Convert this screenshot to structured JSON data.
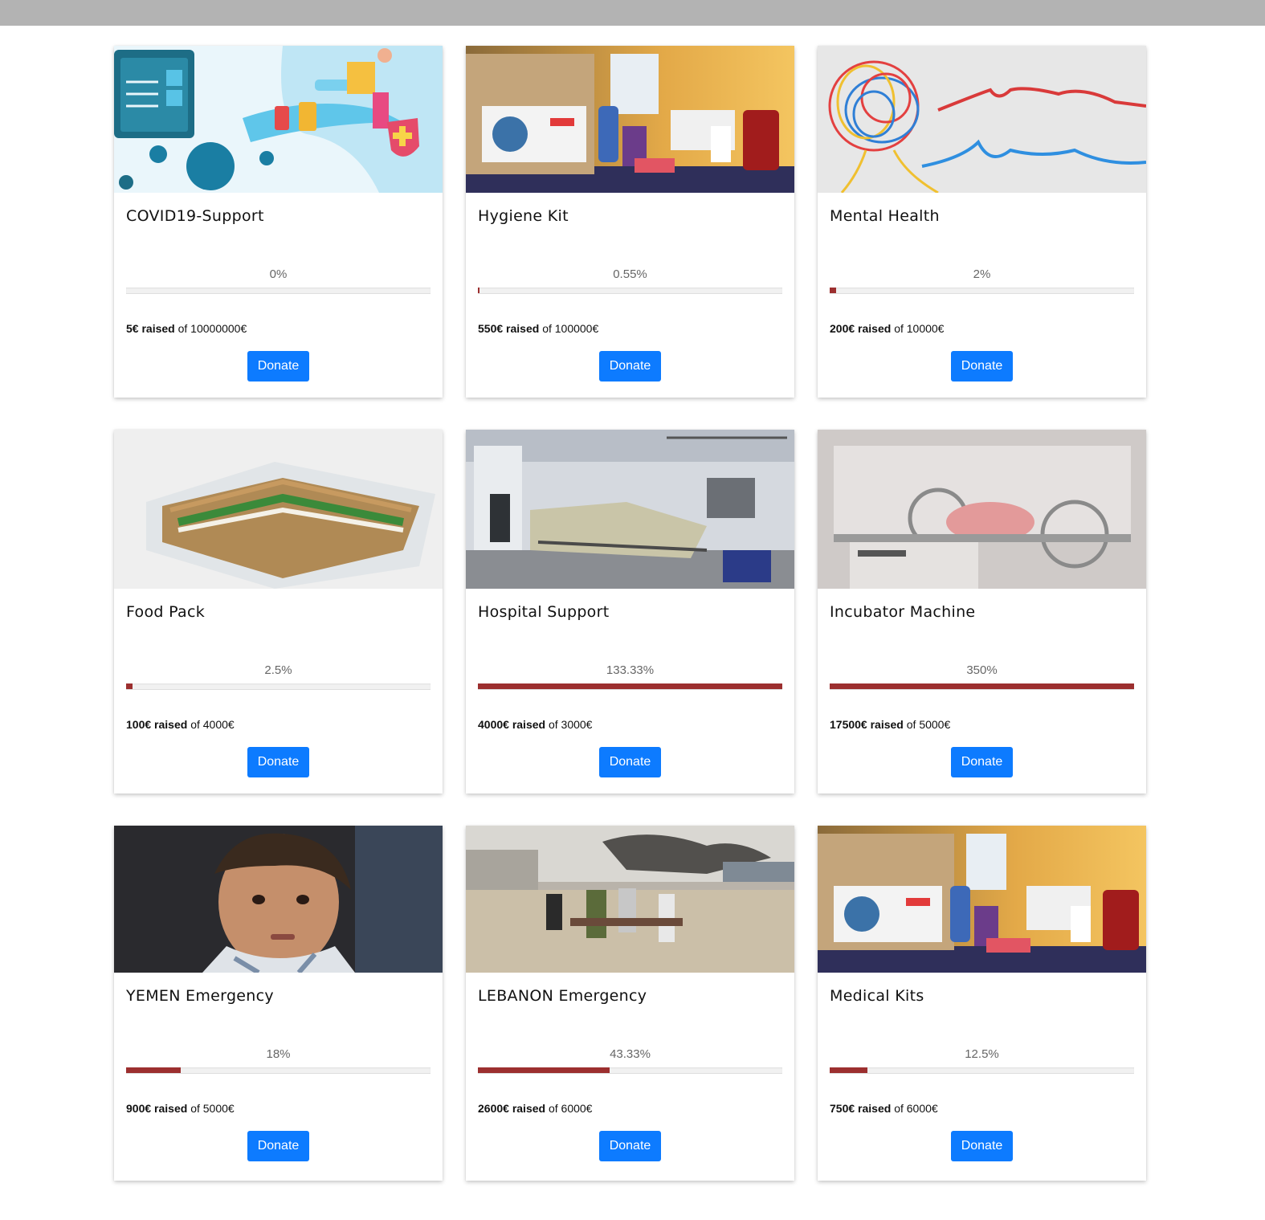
{
  "header": {
    "bar_color": "#b3b3b3"
  },
  "campaigns": [
    {
      "title": "COVID19-Support",
      "percent_label": "0%",
      "progress": 0.0,
      "raised": "5€ raised",
      "goal": "of 10000000€",
      "donate_label": "Donate",
      "image": "covid-illustration"
    },
    {
      "title": "Hygiene Kit",
      "percent_label": "0.55%",
      "progress": 0.0055,
      "raised": "550€ raised",
      "goal": "of 100000€",
      "donate_label": "Donate",
      "image": "hygiene-kit-photo"
    },
    {
      "title": "Mental Health",
      "percent_label": "2%",
      "progress": 0.02,
      "raised": "200€ raised",
      "goal": "of 10000€",
      "donate_label": "Donate",
      "image": "mental-health-yarn-photo"
    },
    {
      "title": "Food Pack",
      "percent_label": "2.5%",
      "progress": 0.025,
      "raised": "100€ raised",
      "goal": "of 4000€",
      "donate_label": "Donate",
      "image": "sandwich-photo"
    },
    {
      "title": "Hospital Support",
      "percent_label": "133.33%",
      "progress": 1.0,
      "raised": "4000€ raised",
      "goal": "of 3000€",
      "donate_label": "Donate",
      "image": "hospital-ward-photo"
    },
    {
      "title": "Incubator Machine",
      "percent_label": "350%",
      "progress": 1.0,
      "raised": "17500€ raised",
      "goal": "of 5000€",
      "donate_label": "Donate",
      "image": "incubator-photo"
    },
    {
      "title": "YEMEN Emergency",
      "percent_label": "18%",
      "progress": 0.18,
      "raised": "900€ raised",
      "goal": "of 5000€",
      "donate_label": "Donate",
      "image": "child-portrait-photo"
    },
    {
      "title": "LEBANON Emergency",
      "percent_label": "43.33%",
      "progress": 0.4333,
      "raised": "2600€ raised",
      "goal": "of 6000€",
      "donate_label": "Donate",
      "image": "beirut-explosion-photo"
    },
    {
      "title": "Medical Kits",
      "percent_label": "12.5%",
      "progress": 0.125,
      "raised": "750€ raised",
      "goal": "of 6000€",
      "donate_label": "Donate",
      "image": "medical-kit-photo"
    }
  ],
  "colors": {
    "progress_fill": "#9c2f2f",
    "button": "#0d7bff"
  }
}
